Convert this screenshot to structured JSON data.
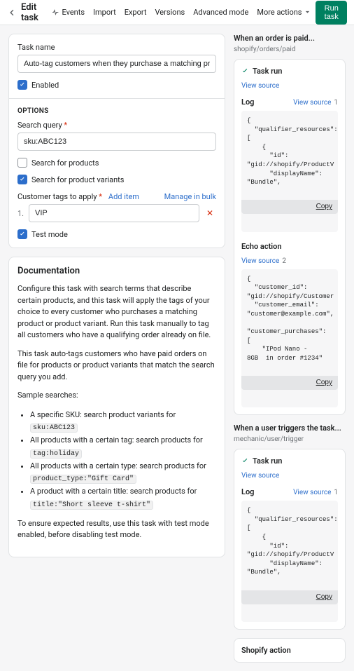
{
  "topbar": {
    "title": "Edit task",
    "nav": [
      "Events",
      "Import",
      "Export",
      "Versions",
      "Advanced mode",
      "More actions"
    ],
    "run": "Run task"
  },
  "form": {
    "task_name_label": "Task name",
    "task_name_value": "Auto-tag customers when they purchase a matching product",
    "enabled_label": "Enabled",
    "options_heading": "OPTIONS",
    "search_query_label": "Search query",
    "search_query_value": "sku:ABC123",
    "search_products_label": "Search for products",
    "search_variants_label": "Search for product variants",
    "tags_label": "Customer tags to apply",
    "add_item": "Add item",
    "manage_bulk": "Manage in bulk",
    "tag_num": "1.",
    "tag_value": "VIP",
    "test_mode_label": "Test mode"
  },
  "doc": {
    "heading": "Documentation",
    "p1": "Configure this task with search terms that describe certain products, and this task will apply the tags of your choice to every customer who purchases a matching product or product variant. Run this task manually to tag all customers who have a qualifying order already on file.",
    "p2": "This task auto-tags customers who have paid orders on file for products or product variants that match the search query you add.",
    "p3": "Sample searches:",
    "li1a": "A specific SKU: search product variants for ",
    "li1b": "sku:ABC123",
    "li2a": "All products with a certain tag: search products for ",
    "li2b": "tag:holiday",
    "li3a": "All products with a certain type: search products for ",
    "li3b": "product_type:\"Gift Card\"",
    "li4a": "A product with a certain title: search products for ",
    "li4b": "title:\"Short sleeve t-shirt\"",
    "p4": "To ensure expected results, use this task with test mode enabled, before disabling test mode."
  },
  "side": {
    "evt1_title": "When an order is paid...",
    "evt1_topic": "shopify/orders/paid",
    "task_run": "Task run",
    "view_source": "View source",
    "log": "Log",
    "count1": "1",
    "code1": "{\n  \"qualifier_resources\":\n[\n    {\n      \"id\":\n\"gid://shopify/ProductV\n      \"displayName\":\n\"Bundle\",",
    "copy": "Copy",
    "echo_h": "Echo action",
    "echo_count": "2",
    "code2": "{\n  \"customer_id\":\n\"gid://shopify/Customer\n  \"customer_email\":\n\"customer@example.com\",\n\n\"customer_purchases\":\n[\n    \"IPod Nano -\n8GB  in order #1234\"",
    "evt2_title": "When a user triggers the task...",
    "evt2_topic": "mechanic/user/trigger",
    "shopify_action": "Shopify action"
  }
}
